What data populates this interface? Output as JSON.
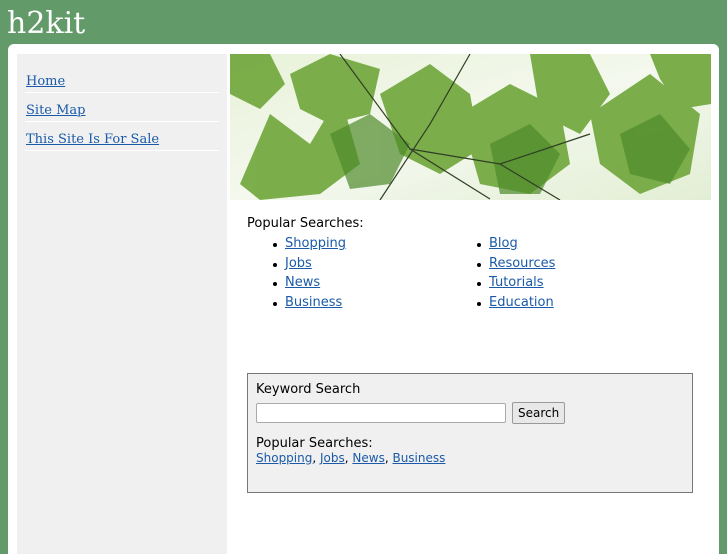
{
  "site": {
    "title": "h2kit"
  },
  "sidebar": {
    "items": [
      {
        "label": "Home"
      },
      {
        "label": "Site Map"
      },
      {
        "label": "This Site Is For Sale"
      }
    ]
  },
  "popular": {
    "heading": "Popular Searches:",
    "left": [
      {
        "label": "Shopping"
      },
      {
        "label": "Jobs"
      },
      {
        "label": "News"
      },
      {
        "label": "Business"
      }
    ],
    "right": [
      {
        "label": "Blog"
      },
      {
        "label": "Resources"
      },
      {
        "label": "Tutorials"
      },
      {
        "label": "Education"
      }
    ]
  },
  "search": {
    "title": "Keyword Search",
    "input_value": "",
    "button_label": "Search",
    "popular_heading": "Popular Searches:",
    "links": [
      {
        "label": "Shopping"
      },
      {
        "label": "Jobs"
      },
      {
        "label": "News"
      },
      {
        "label": "Business"
      }
    ],
    "separator": ", "
  },
  "colors": {
    "background": "#639a69",
    "sidebar": "#f0f0f0",
    "link": "#1a5aa8"
  }
}
